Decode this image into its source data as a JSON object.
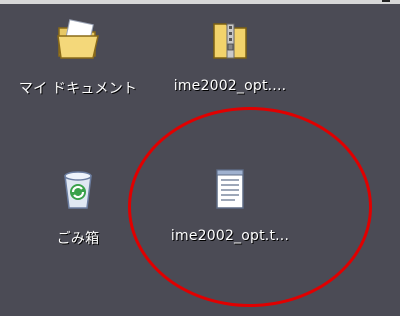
{
  "desktop": {
    "icons": [
      {
        "label": "マイ ドキュメント",
        "icon": "my-documents-folder-icon"
      },
      {
        "label": "ime2002_opt....",
        "icon": "zip-archive-icon"
      },
      {
        "label": "ごみ箱",
        "icon": "recycle-bin-icon"
      },
      {
        "label": "ime2002_opt.t...",
        "icon": "text-file-icon"
      }
    ]
  },
  "annotation": {
    "type": "red-circle-highlight",
    "color": "#e00000"
  }
}
